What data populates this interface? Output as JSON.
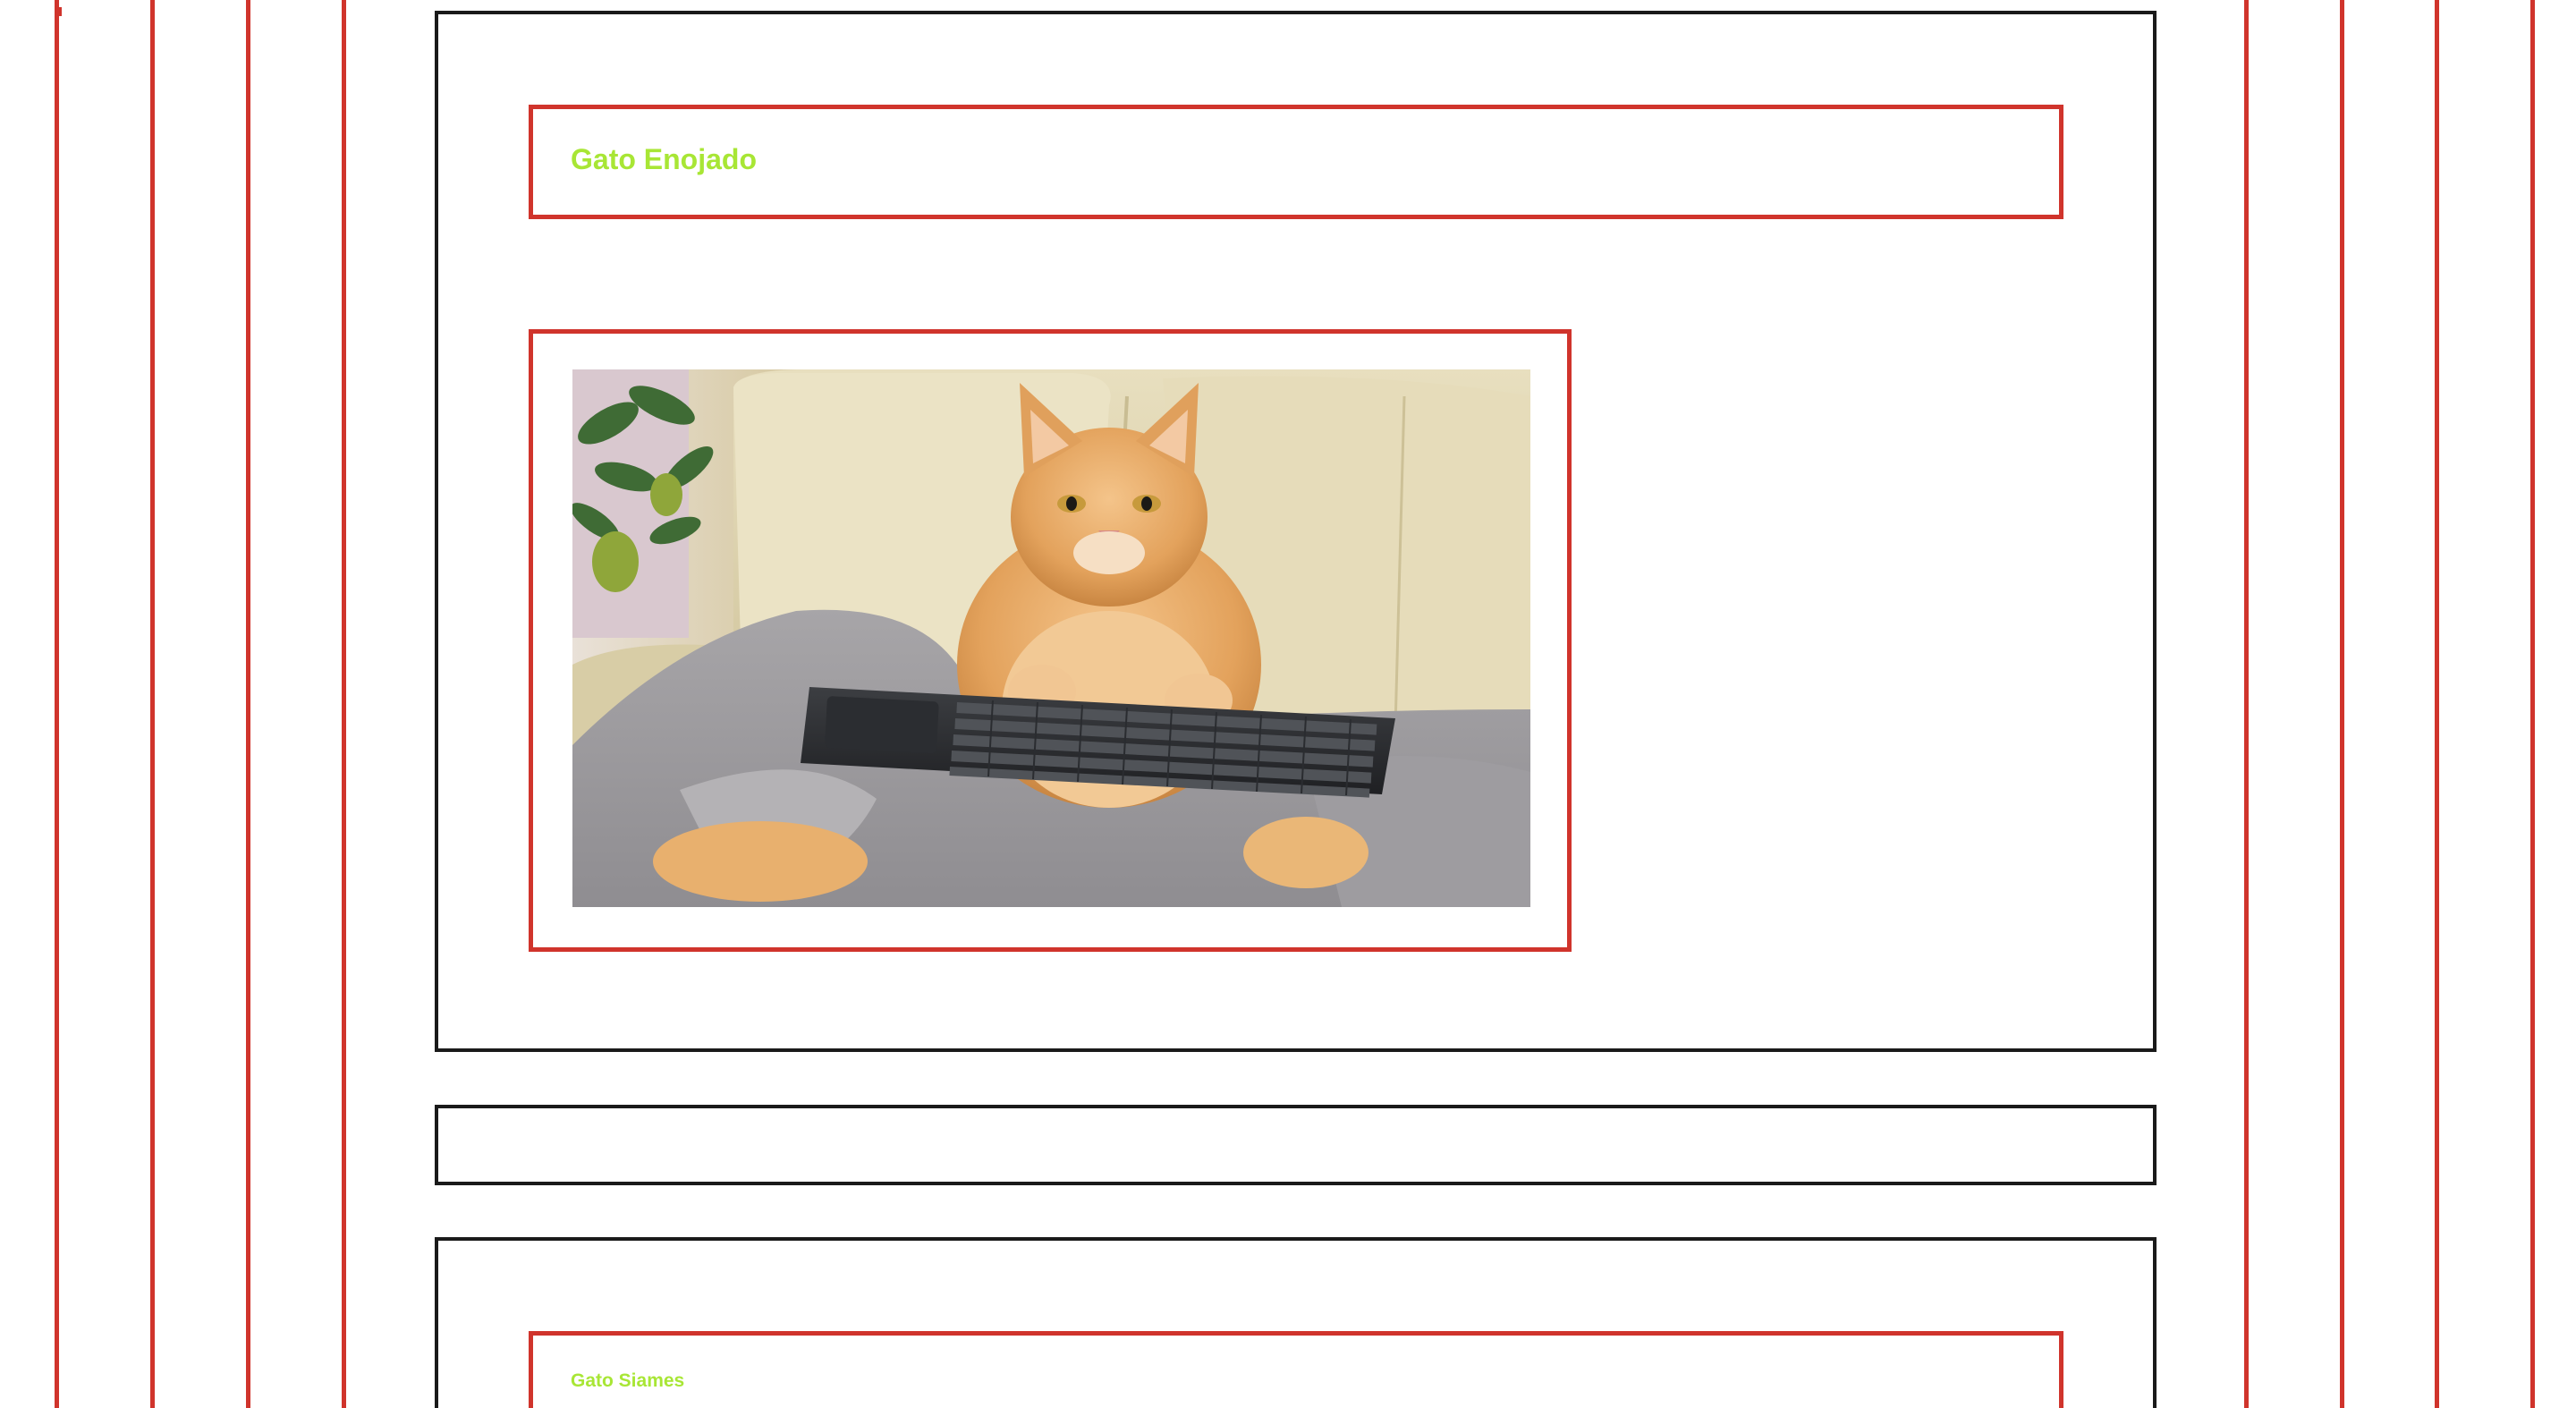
{
  "cards": [
    {
      "title": "Gato Enojado",
      "image_alt": "orange long-haired cat sitting on a beige leather sofa with a black keyboard"
    },
    {
      "title": ""
    },
    {
      "title": "Gato Siames"
    }
  ],
  "colors": {
    "border_red": "#d0342c",
    "border_black": "#1a1a1a",
    "title_green": "#a8e635",
    "background": "#ffffff"
  }
}
